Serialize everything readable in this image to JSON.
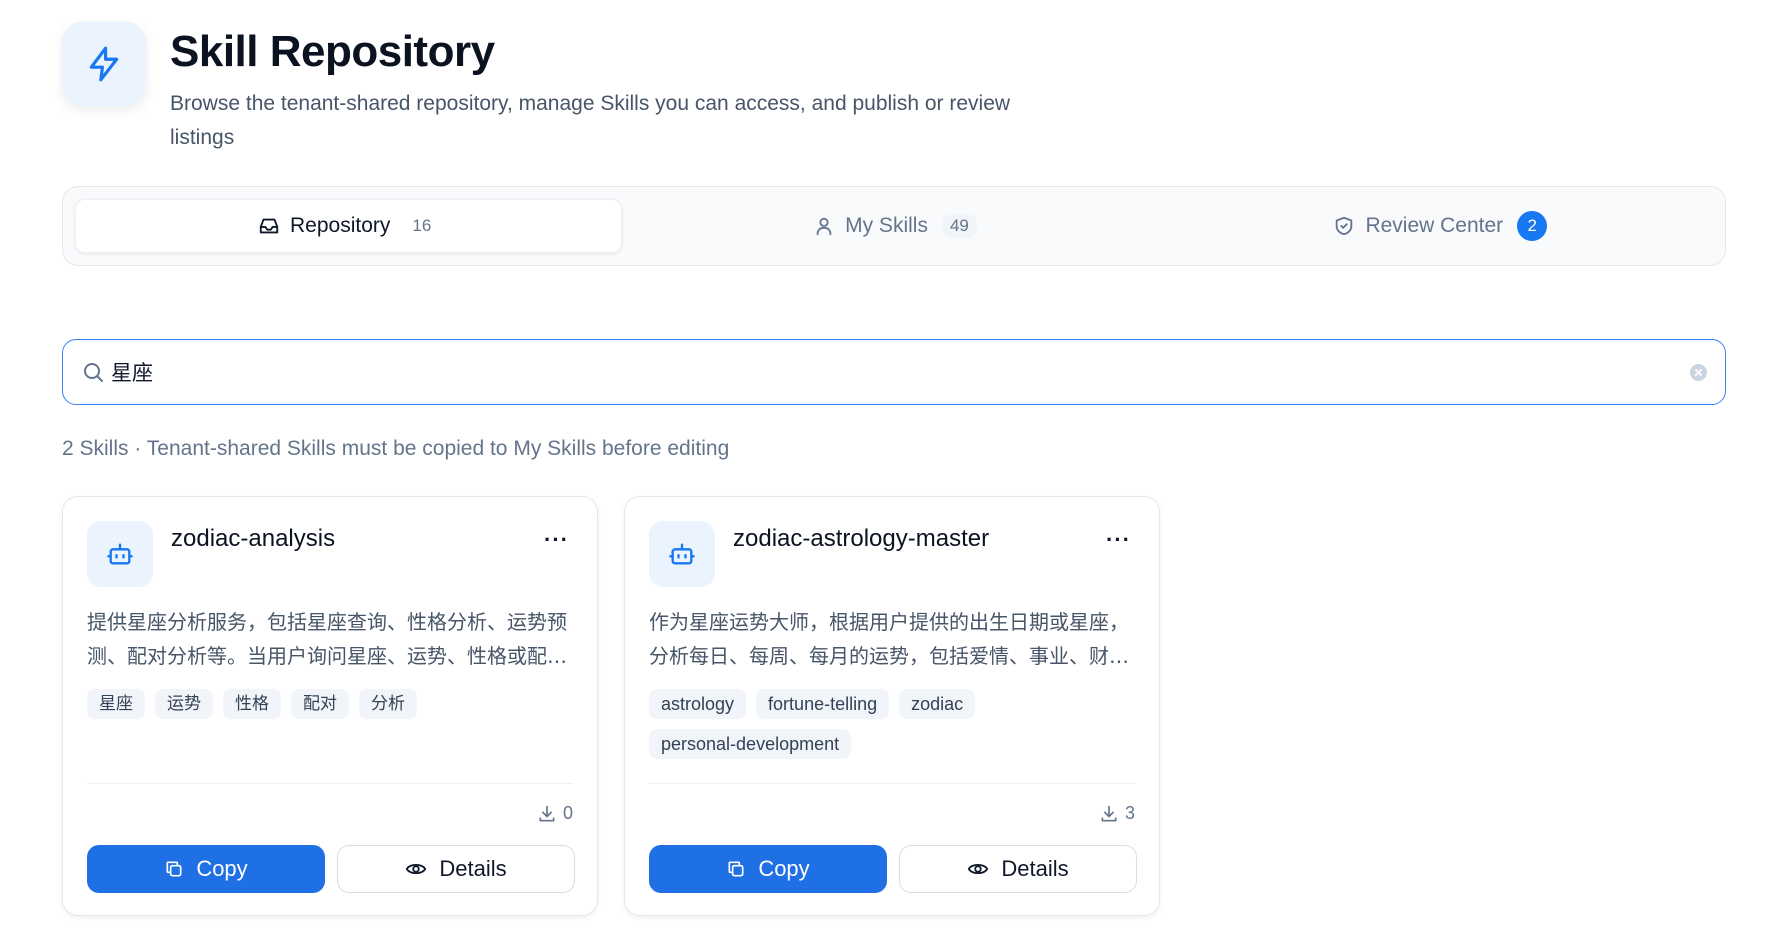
{
  "header": {
    "icon": "lightning-icon",
    "title": "Skill Repository",
    "subtitle": "Browse the tenant-shared repository, manage Skills you can access, and publish or review listings"
  },
  "tabs": [
    {
      "label": "Repository",
      "count": "16",
      "icon": "inbox-icon",
      "active": true
    },
    {
      "label": "My Skills",
      "count": "49",
      "icon": "user-icon",
      "active": false
    },
    {
      "label": "Review Center",
      "count": "2",
      "icon": "shield-check-icon",
      "active": false
    }
  ],
  "search": {
    "value": "星座",
    "placeholder": ""
  },
  "result_summary": "2 Skills · Tenant-shared Skills must be copied to My Skills before editing",
  "cards": [
    {
      "name": "zodiac-analysis",
      "description": "提供星座分析服务，包括星座查询、性格分析、运势预测、配对分析等。当用户询问星座、运势、性格或配对相关问题时使用",
      "tags": [
        "星座",
        "运势",
        "性格",
        "配对",
        "分析"
      ],
      "downloads": "0",
      "copy_label": "Copy",
      "details_label": "Details"
    },
    {
      "name": "zodiac-astrology-master",
      "description": "作为星座运势大师，根据用户提供的出生日期或星座，分析每日、每周、每月的运势，包括爱情、事业、财运和健康",
      "tags": [
        "astrology",
        "fortune-telling",
        "zodiac",
        "personal-development"
      ],
      "downloads": "3",
      "copy_label": "Copy",
      "details_label": "Details"
    }
  ],
  "colors": {
    "accent": "#1778f2",
    "primary_button": "#1f6fe5",
    "icon_bg": "#eaf3fe"
  }
}
